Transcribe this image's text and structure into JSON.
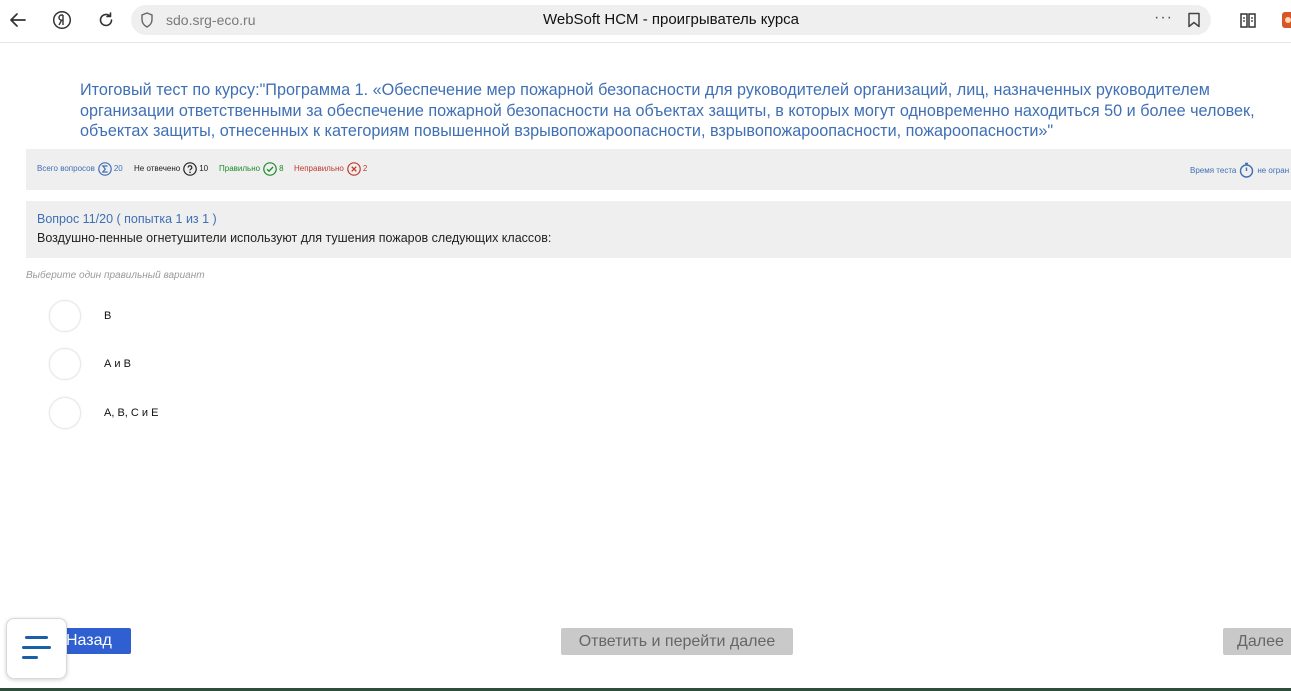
{
  "browser": {
    "url": "sdo.srg-eco.ru",
    "title": "WebSoft HCM - проигрыватель курса",
    "more_label": "···"
  },
  "course": {
    "title": "Итоговый тест по курсу:\"Программа 1. «Обеспечение мер пожарной безопасности для руководителей организаций, лиц, назначенных руководителем организации ответственными за обеспечение пожарной безопасности на объектах защиты, в которых могут одновременно находиться 50 и более человек, объектах защиты, отнесенных к категориям повышенной взрывопожароопасности, взрывопожароопасности, пожароопасности»\""
  },
  "stats": {
    "total_label": "Всего вопросов",
    "total_value": "20",
    "unanswered_label": "Не отвечено",
    "unanswered_value": "10",
    "correct_label": "Правильно",
    "correct_value": "8",
    "wrong_label": "Неправильно",
    "wrong_value": "2",
    "time_label": "Время теста",
    "time_value": "не огран"
  },
  "question": {
    "number": "Вопрос 11/20  ( попытка  1 из 1 )",
    "text": "Воздушно-пенные огнетушители используют для тушения пожаров следующих классов:",
    "hint": "Выберите один правильный вариант",
    "options": [
      {
        "label": "В"
      },
      {
        "label": "А и В"
      },
      {
        "label": "А, В, С и Е"
      }
    ]
  },
  "controls": {
    "back": "Назад",
    "answer_next": "Ответить и перейти далее",
    "next": "Далее"
  },
  "colors": {
    "accent": "#3f6fb5",
    "back_button": "#2f5fd0",
    "disabled_button": "#c9c9c9",
    "correct": "#1d8a2a",
    "wrong": "#c0392b"
  }
}
